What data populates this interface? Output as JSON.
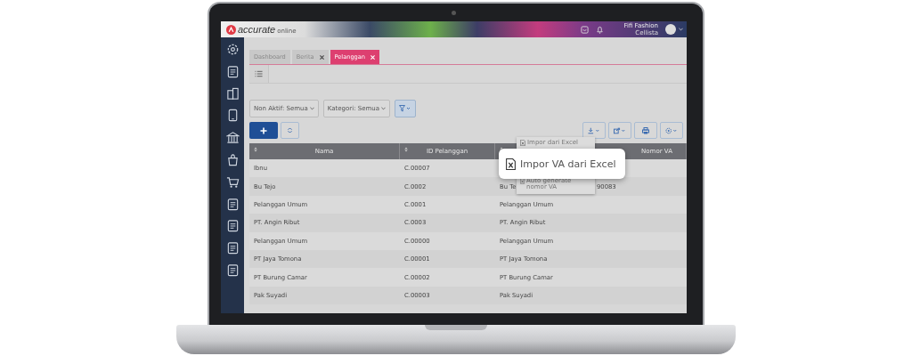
{
  "header": {
    "logo": "accurate",
    "logo_sub": "online",
    "company": "Fifi Fashion",
    "user": "Cellista"
  },
  "tabs": [
    {
      "label": "Dashboard",
      "closable": false,
      "selected": false
    },
    {
      "label": "Berita",
      "closable": true,
      "selected": false
    },
    {
      "label": "Pelanggan",
      "closable": true,
      "selected": true
    }
  ],
  "filters": [
    "Non Aktif: Semua",
    "Kategori: Semua"
  ],
  "import_menu": {
    "items": [
      {
        "label": "Impor dari Excel",
        "selected": false
      },
      {
        "label": "Impor VA dari Excel",
        "selected": true
      },
      {
        "label": "Auto generate nomor VA",
        "selected": false
      }
    ]
  },
  "table": {
    "columns": [
      {
        "label": "Nama",
        "sortable": true
      },
      {
        "label": "ID Pelanggan",
        "sortable": true
      },
      {
        "sortable": true
      },
      {
        "label": "Nomor VA",
        "sortable": false
      }
    ],
    "rows": [
      {
        "cells": [
          "Ibnu",
          "C.00007"
        ]
      },
      {
        "cells": [
          "Bu Tejo",
          "C.0002",
          "Bu Te",
          "90083"
        ]
      },
      {
        "cells": [
          "Pelanggan Umum",
          "C.0001",
          "Pelanggan Umum"
        ]
      },
      {
        "cells": [
          "PT. Angin Ribut",
          "C.0003",
          "PT. Angin Ribut"
        ]
      },
      {
        "cells": [
          "Pelanggan Umum",
          "C.00000",
          "Pelanggan Umum"
        ]
      },
      {
        "cells": [
          "PT Jaya Tomona",
          "C.00001",
          "PT Jaya Tomona"
        ]
      },
      {
        "cells": [
          "PT Burung Camar",
          "C.00002",
          "PT Burung Camar"
        ]
      },
      {
        "cells": [
          "Pak Suyadi",
          "C.00003",
          "Pak Suyadi"
        ]
      }
    ]
  }
}
